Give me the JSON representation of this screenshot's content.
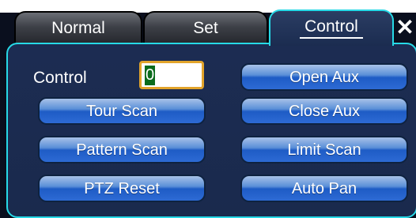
{
  "tabs": [
    {
      "label": "Normal"
    },
    {
      "label": "Set"
    },
    {
      "label": "Control"
    }
  ],
  "close_label": "✕",
  "control": {
    "label": "Control",
    "value": "0"
  },
  "buttons": {
    "tour_scan": "Tour Scan",
    "pattern_scan": "Pattern Scan",
    "ptz_reset": "PTZ Reset",
    "open_aux": "Open Aux",
    "close_aux": "Close Aux",
    "limit_scan": "Limit Scan",
    "auto_pan": "Auto Pan"
  },
  "colors": {
    "accent_border": "#27d9e6",
    "panel_background": "#1c2c52",
    "button_blue": "#2d6ad4",
    "input_border": "#e2a42b",
    "input_cursor": "#0b6b1c"
  }
}
